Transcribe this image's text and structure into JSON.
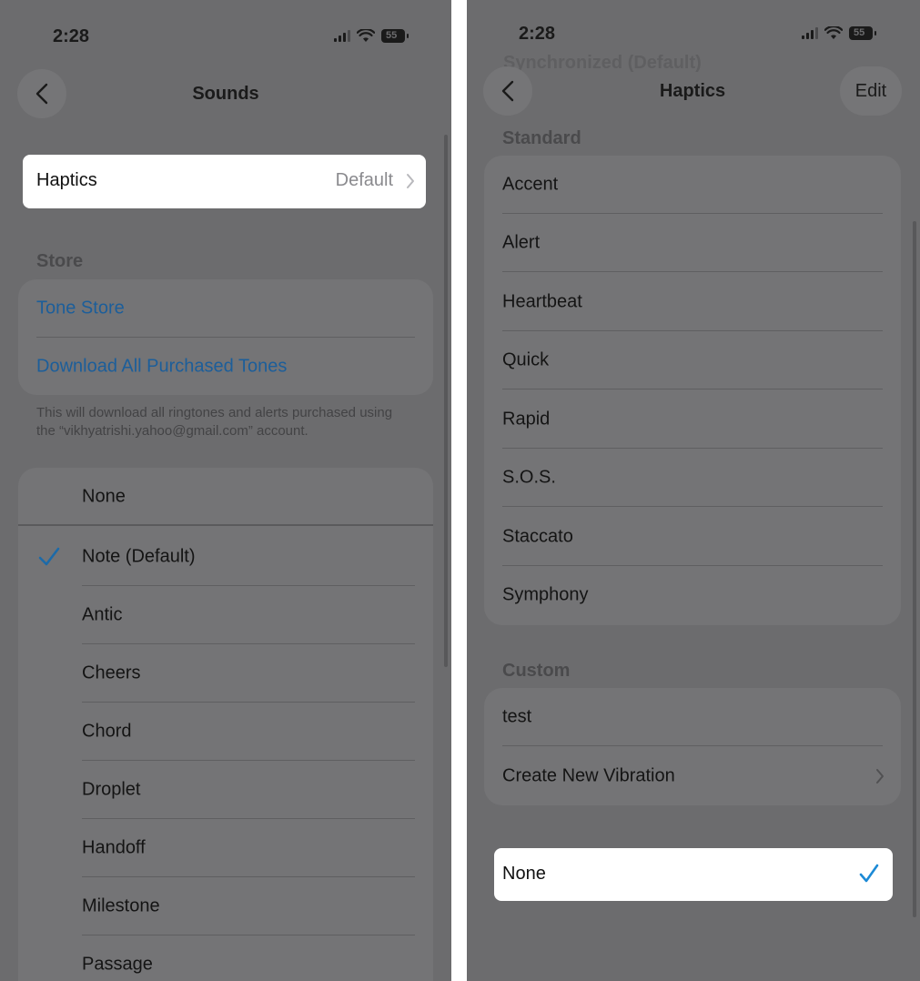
{
  "left": {
    "status_time": "2:28",
    "battery": "55",
    "nav_title": "Sounds",
    "haptics_label": "Haptics",
    "haptics_value": "Default",
    "store_header": "Store",
    "tone_store": "Tone Store",
    "download_all": "Download All Purchased Tones",
    "footnote": "This will download all ringtones and alerts purchased using the “vikhyatrishi.yahoo@gmail.com” account.",
    "tones": [
      {
        "label": "None",
        "selected": false
      },
      {
        "label": "Note (Default)",
        "selected": true
      },
      {
        "label": "Antic",
        "selected": false
      },
      {
        "label": "Cheers",
        "selected": false
      },
      {
        "label": "Chord",
        "selected": false
      },
      {
        "label": "Droplet",
        "selected": false
      },
      {
        "label": "Handoff",
        "selected": false
      },
      {
        "label": "Milestone",
        "selected": false
      },
      {
        "label": "Passage",
        "selected": false
      }
    ]
  },
  "right": {
    "status_time": "2:28",
    "battery": "55",
    "nav_title": "Haptics",
    "edit_label": "Edit",
    "synchronized_partial": "Synchronized (Default)",
    "standard_header": "Standard",
    "standard_items": [
      "Accent",
      "Alert",
      "Heartbeat",
      "Quick",
      "Rapid",
      "S.O.S.",
      "Staccato",
      "Symphony"
    ],
    "custom_header": "Custom",
    "custom_items": [
      "test",
      "Create New Vibration"
    ],
    "none_label": "None",
    "none_selected": true
  },
  "colors": {
    "overlay_gray": "#6c6c6e",
    "accent_blue": "#1c8ad6",
    "highlight": "#ffffff"
  }
}
